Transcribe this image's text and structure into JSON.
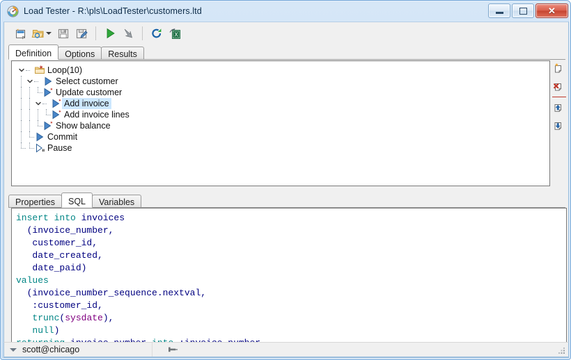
{
  "window": {
    "title": "Load Tester - R:\\pls\\LoadTester\\customers.ltd",
    "app_icon": "gauge-icon",
    "controls": {
      "minimize_label": "–",
      "maximize_label": "□",
      "close_label": "✕"
    },
    "accent_blue": "#6fa5d8",
    "close_red": "#c64430"
  },
  "toolbar": {
    "items": [
      {
        "name": "new-file-icon",
        "title": "New"
      },
      {
        "name": "open-file-icon",
        "title": "Open"
      },
      {
        "name": "open-dropdown-caret-icon",
        "title": "Open recent"
      },
      {
        "name": "save-icon",
        "title": "Save"
      },
      {
        "name": "save-as-icon",
        "title": "Save As"
      },
      {
        "name": "separator",
        "title": ""
      },
      {
        "name": "run-icon",
        "title": "Run"
      },
      {
        "name": "stop-icon",
        "title": "Stop"
      },
      {
        "name": "separator",
        "title": ""
      },
      {
        "name": "refresh-icon",
        "title": "Refresh"
      },
      {
        "name": "export-excel-icon",
        "title": "Export to Excel"
      }
    ]
  },
  "main_tabs": {
    "items": [
      {
        "label": "Definition",
        "active": true
      },
      {
        "label": "Options",
        "active": false
      },
      {
        "label": "Results",
        "active": false
      }
    ]
  },
  "tree": {
    "nodes": [
      {
        "label": "Loop(10)",
        "depth": 0,
        "icon": "loop-folder-icon",
        "expanded": true,
        "selected": false,
        "starred": true
      },
      {
        "label": "Select customer",
        "depth": 1,
        "icon": "statement-icon",
        "expanded": true,
        "selected": false,
        "starred": false
      },
      {
        "label": "Update customer",
        "depth": 2,
        "icon": "statement-icon",
        "expanded": null,
        "selected": false,
        "starred": true
      },
      {
        "label": "Add invoice",
        "depth": 2,
        "icon": "statement-icon",
        "expanded": true,
        "selected": true,
        "starred": true
      },
      {
        "label": "Add invoice lines",
        "depth": 3,
        "icon": "statement-icon",
        "expanded": null,
        "selected": false,
        "starred": true
      },
      {
        "label": "Show balance",
        "depth": 2,
        "icon": "statement-icon",
        "expanded": null,
        "selected": false,
        "starred": true
      },
      {
        "label": "Commit",
        "depth": 1,
        "icon": "commit-icon",
        "expanded": null,
        "selected": false,
        "starred": false
      },
      {
        "label": "Pause",
        "depth": 1,
        "icon": "pause-icon",
        "expanded": null,
        "selected": false,
        "starred": false
      }
    ]
  },
  "side_buttons": {
    "items": [
      {
        "name": "add-statement-button",
        "title": "Add statement"
      },
      {
        "name": "delete-statement-button",
        "title": "Delete statement"
      },
      {
        "name": "move-up-button",
        "title": "Move up"
      },
      {
        "name": "move-down-button",
        "title": "Move down"
      }
    ]
  },
  "detail_tabs": {
    "items": [
      {
        "label": "Properties",
        "active": false
      },
      {
        "label": "SQL",
        "active": true
      },
      {
        "label": "Variables",
        "active": false
      }
    ]
  },
  "sql_editor": {
    "lines": [
      [
        {
          "t": "insert into ",
          "c": "kw"
        },
        {
          "t": "invoices",
          "c": "id"
        }
      ],
      [
        {
          "t": "  (invoice_number,",
          "c": "id"
        }
      ],
      [
        {
          "t": "   customer_id,",
          "c": "id"
        }
      ],
      [
        {
          "t": "   date_created,",
          "c": "id"
        }
      ],
      [
        {
          "t": "   date_paid)",
          "c": "id"
        }
      ],
      [
        {
          "t": "values",
          "c": "kw"
        }
      ],
      [
        {
          "t": "  (invoice_number_sequence.nextval,",
          "c": "id"
        }
      ],
      [
        {
          "t": "   :customer_id,",
          "c": "id"
        }
      ],
      [
        {
          "t": "   ",
          "c": "id"
        },
        {
          "t": "trunc",
          "c": "fn"
        },
        {
          "t": "(",
          "c": "id"
        },
        {
          "t": "sysdate",
          "c": "sysd"
        },
        {
          "t": "),",
          "c": "id"
        }
      ],
      [
        {
          "t": "   ",
          "c": "id"
        },
        {
          "t": "null",
          "c": "kw"
        },
        {
          "t": ")",
          "c": "id"
        }
      ],
      [
        {
          "t": "returning ",
          "c": "kw"
        },
        {
          "t": "invoice_number ",
          "c": "id"
        },
        {
          "t": "into ",
          "c": "kw"
        },
        {
          "t": ":invoice_number",
          "c": "id"
        }
      ]
    ],
    "keyword_color": "#008585",
    "identifier_color": "#000080",
    "sysdate_color": "#800080"
  },
  "statusbar": {
    "connection": "scott@chicago",
    "dropdown_icon": "chevron-down-icon",
    "pin_icon": "pin-icon",
    "grip_icon": "resize-grip-icon"
  }
}
